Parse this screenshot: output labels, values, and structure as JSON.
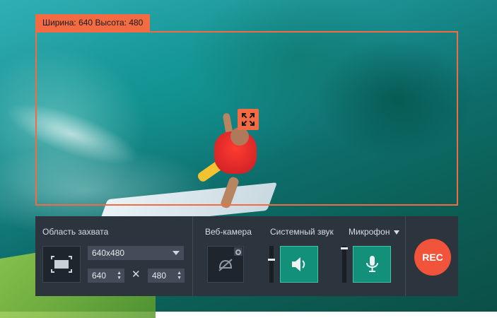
{
  "overlay": {
    "size_label": {
      "width_label": "Ширина:",
      "width_value": "640",
      "height_label": "Высота:",
      "height_value": "480"
    }
  },
  "panel": {
    "capture_area": {
      "title": "Область захвата",
      "preset": "640x480",
      "width": "640",
      "height": "480",
      "times": "✕"
    },
    "webcam": {
      "title": "Веб-камера"
    },
    "system_sound": {
      "title": "Системный звук",
      "volume_level": 0.37
    },
    "microphone": {
      "title": "Микрофон",
      "volume_level": 0.04
    },
    "rec": {
      "label": "REC"
    }
  },
  "colors": {
    "accent": "#f26b43",
    "panel_bg": "#2c343e",
    "active_green": "#13907a",
    "rec_red": "#f2543b"
  }
}
